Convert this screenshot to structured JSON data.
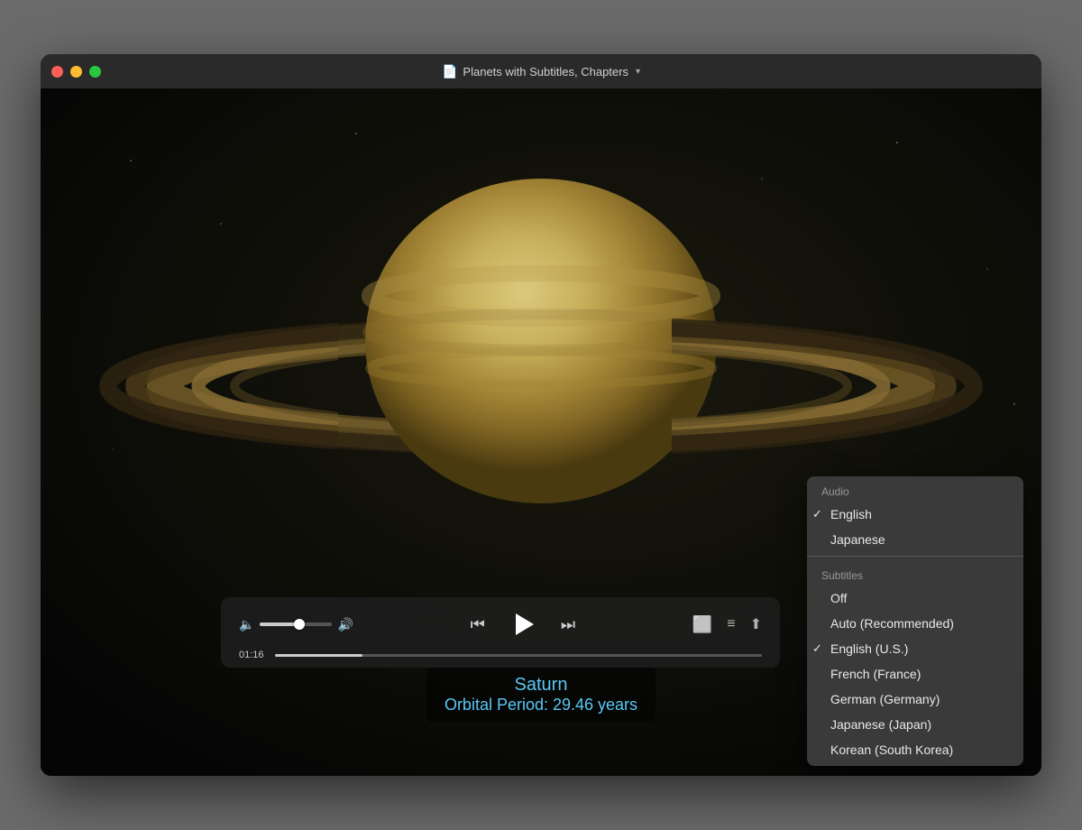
{
  "window": {
    "title": "Planets with Subtitles, Chapters",
    "title_icon": "📄"
  },
  "traffic_lights": {
    "close_color": "#ff5f57",
    "min_color": "#febc2e",
    "max_color": "#28c840"
  },
  "player": {
    "current_time": "01:16",
    "progress_percent": 18,
    "volume_percent": 55
  },
  "subtitles": {
    "line1": "Saturn",
    "line2": "Orbital Period: 29.46 years"
  },
  "controls": {
    "rewind_label": "⏮",
    "play_label": "▶",
    "forward_label": "⏭",
    "subtitles_icon": "subtitles",
    "chapters_icon": "chapters",
    "share_icon": "share"
  },
  "dropdown": {
    "audio_section": "Audio",
    "audio_items": [
      {
        "label": "English",
        "checked": true
      },
      {
        "label": "Japanese",
        "checked": false
      }
    ],
    "subtitles_section": "Subtitles",
    "subtitle_items": [
      {
        "label": "Off",
        "checked": false
      },
      {
        "label": "Auto (Recommended)",
        "checked": false
      },
      {
        "label": "English (U.S.)",
        "checked": true
      },
      {
        "label": "French (France)",
        "checked": false
      },
      {
        "label": "German (Germany)",
        "checked": false
      },
      {
        "label": "Japanese (Japan)",
        "checked": false
      },
      {
        "label": "Korean (South Korea)",
        "checked": false
      }
    ]
  }
}
